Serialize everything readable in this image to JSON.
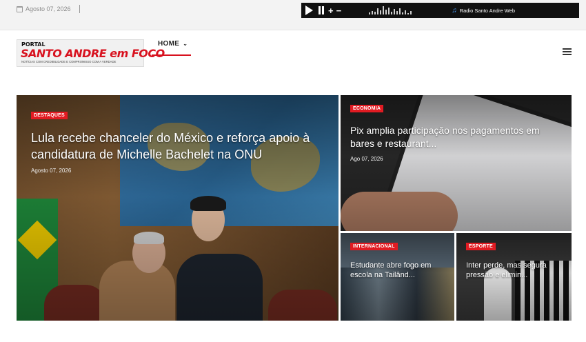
{
  "topbar": {
    "date": "Agosto 07, 2026",
    "player": {
      "station": "Radio Santo Andre Web",
      "icons": [
        "calendar-icon",
        "play-icon",
        "pause-icon",
        "volume-up-icon",
        "volume-down-icon",
        "equalizer-icon",
        "music-note-icon"
      ]
    }
  },
  "header": {
    "logo": {
      "portal": "PORTAL",
      "name": "SANTO ANDRE em FOCO",
      "tagline": "NOTÍCIAS COM CREDIBILIDADE E COMPROMISSO COM A VERDADE"
    },
    "nav": {
      "home_label": "HOME",
      "home_chevron": "⌄"
    }
  },
  "colors": {
    "accent": "#e11b22",
    "nav_underline": "#d8121f",
    "player_bg": "#111111"
  },
  "articles": [
    {
      "category": "DESTAQUES",
      "title": "Lula recebe chanceler do México e reforça apoio à candidatura de Michelle Bachelet na ONU",
      "date": "Agosto 07, 2026"
    },
    {
      "category": "ECONOMIA",
      "title": "Pix amplia participação nos pagamentos em bares e restaurant...",
      "date": "Ago 07, 2026"
    },
    {
      "category": "INTERNACIONAL",
      "title": "Estudante abre fogo em escola na Tailând..."
    },
    {
      "category": "ESPORTE",
      "title": "Inter perde, mas segura pressão e elimin..."
    }
  ]
}
